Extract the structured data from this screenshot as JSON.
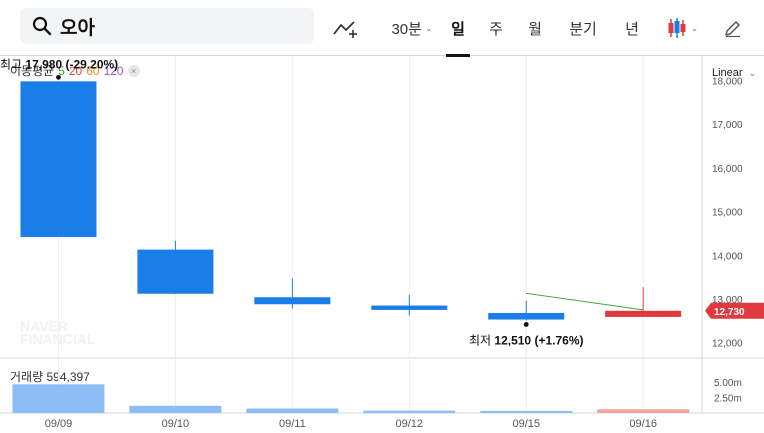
{
  "search": {
    "query": "오아"
  },
  "toolbar": {
    "periods": [
      "30분",
      "일",
      "주",
      "월",
      "분기",
      "년"
    ],
    "active_period": "일"
  },
  "legend": {
    "ma_label": "이동평균",
    "ma_periods": [
      {
        "label": "5",
        "color": "#38a534"
      },
      {
        "label": "20",
        "color": "#e8413a"
      },
      {
        "label": "60",
        "color": "#f08b1c"
      },
      {
        "label": "120",
        "color": "#9b55c9"
      }
    ],
    "close_icon": "close-icon"
  },
  "scale": {
    "label": "Linear"
  },
  "watermark": {
    "line1": "NAVER",
    "line2": "FINANCIAL"
  },
  "volume": {
    "label": "거래량",
    "value": "594,397"
  },
  "chart_data": {
    "type": "candlestick",
    "categories": [
      "09/09",
      "09/10",
      "09/11",
      "09/12",
      "09/15",
      "09/16"
    ],
    "candles": [
      {
        "date": "09/09",
        "open": 17980,
        "high": 17980,
        "low": 14420,
        "close": 14420,
        "direction": "down"
      },
      {
        "date": "09/10",
        "open": 14130,
        "high": 14330,
        "low": 13120,
        "close": 13120,
        "direction": "down"
      },
      {
        "date": "09/11",
        "open": 13040,
        "high": 13470,
        "low": 12780,
        "close": 12880,
        "direction": "down"
      },
      {
        "date": "09/12",
        "open": 12850,
        "high": 13100,
        "low": 12620,
        "close": 12750,
        "direction": "down"
      },
      {
        "date": "09/15",
        "open": 12680,
        "high": 12960,
        "low": 12510,
        "close": 12530,
        "direction": "down"
      },
      {
        "date": "09/16",
        "open": 12590,
        "high": 13270,
        "low": 12590,
        "close": 12730,
        "direction": "up"
      }
    ],
    "moving_average_5": [
      {
        "date": "09/15",
        "value": 13130
      },
      {
        "date": "09/16",
        "value": 12750
      }
    ],
    "y_ticks": [
      "18,000",
      "17,000",
      "16,000",
      "15,000",
      "14,000",
      "13,000",
      "12,000"
    ],
    "ylim": [
      11650,
      18560
    ],
    "annotations": {
      "high": {
        "prefix": "최고",
        "value": "17,980",
        "change": "(-29.20%)",
        "price": 17980,
        "date": "09/09"
      },
      "low": {
        "prefix": "최저",
        "value": "12,510",
        "change": "(+1.76%)",
        "price": 12510,
        "date": "09/15"
      }
    },
    "last_price": {
      "label": "12,730",
      "value": 12730,
      "color": "#e03a3e"
    },
    "volume_series": {
      "values": [
        4600000,
        1150000,
        720000,
        380000,
        330000,
        594397
      ],
      "colors": [
        "#8cbdf5",
        "#8cbdf5",
        "#8cbdf5",
        "#8cbdf5",
        "#8cbdf5",
        "#f3a3a3"
      ],
      "ticks": [
        "5.00m",
        "2.50m"
      ],
      "ylim": [
        0,
        8500000
      ]
    },
    "colors": {
      "down": "#1a7ee8",
      "up": "#e03a3e",
      "ma5": "#38a534",
      "grid": "#eceef1"
    }
  }
}
